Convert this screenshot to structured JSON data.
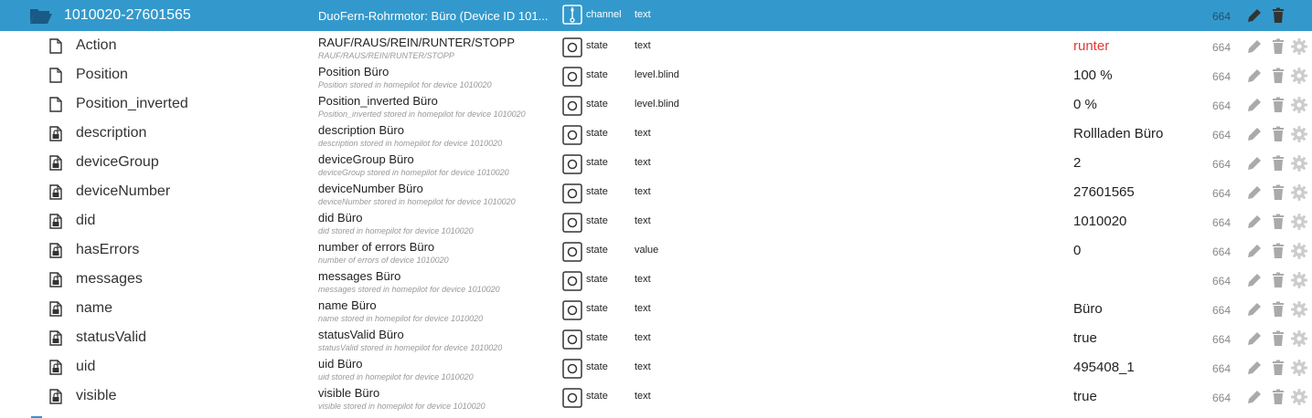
{
  "colors": {
    "header_bg": "#3399cc",
    "header_text": "#ffffff",
    "value_alert": "#e53935",
    "icon_gray": "#aaaaaa"
  },
  "header": {
    "name": "1010020-27601565",
    "title": "DuoFern-Rohrmotor: Büro (Device ID 101...",
    "type": "channel",
    "role": "text",
    "acl": "664",
    "icon": "folder-open-icon",
    "type_icon": "channel-icon"
  },
  "rows": [
    {
      "name": "Action",
      "icon": "file-icon",
      "title": "RAUF/RAUS/REIN/RUNTER/STOPP",
      "desc": "RAUF/RAUS/REIN/RUNTER/STOPP",
      "type": "state",
      "role": "text",
      "value": "runter",
      "acl": "664"
    },
    {
      "name": "Position",
      "icon": "file-icon",
      "title": "Position Büro",
      "desc": "Position stored in homepilot for device 1010020",
      "type": "state",
      "role": "level.blind",
      "value": "100 %",
      "acl": "664"
    },
    {
      "name": "Position_inverted",
      "icon": "file-icon",
      "title": "Position_inverted Büro",
      "desc": "Position_inverted stored in homepilot for device 1010020",
      "type": "state",
      "role": "level.blind",
      "value": "0 %",
      "acl": "664"
    },
    {
      "name": "description",
      "icon": "locked-file-icon",
      "title": "description Büro",
      "desc": "description stored in homepilot for device 1010020",
      "type": "state",
      "role": "text",
      "value": "Rollladen Büro",
      "acl": "664"
    },
    {
      "name": "deviceGroup",
      "icon": "locked-file-icon",
      "title": "deviceGroup Büro",
      "desc": "deviceGroup stored in homepilot for device 1010020",
      "type": "state",
      "role": "text",
      "value": "2",
      "acl": "664"
    },
    {
      "name": "deviceNumber",
      "icon": "locked-file-icon",
      "title": "deviceNumber Büro",
      "desc": "deviceNumber stored in homepilot for device 1010020",
      "type": "state",
      "role": "text",
      "value": "27601565",
      "acl": "664"
    },
    {
      "name": "did",
      "icon": "locked-file-icon",
      "title": "did Büro",
      "desc": "did stored in homepilot for device 1010020",
      "type": "state",
      "role": "text",
      "value": "1010020",
      "acl": "664"
    },
    {
      "name": "hasErrors",
      "icon": "locked-file-icon",
      "title": "number of errors Büro",
      "desc": "number of errors of device 1010020",
      "type": "state",
      "role": "value",
      "value": "0",
      "acl": "664"
    },
    {
      "name": "messages",
      "icon": "locked-file-icon",
      "title": "messages Büro",
      "desc": "messages stored in homepilot for device 1010020",
      "type": "state",
      "role": "text",
      "value": "",
      "acl": "664"
    },
    {
      "name": "name",
      "icon": "locked-file-icon",
      "title": "name Büro",
      "desc": "name stored in homepilot for device 1010020",
      "type": "state",
      "role": "text",
      "value": "Büro",
      "acl": "664"
    },
    {
      "name": "statusValid",
      "icon": "locked-file-icon",
      "title": "statusValid Büro",
      "desc": "statusValid stored in homepilot for device 1010020",
      "type": "state",
      "role": "text",
      "value": "true",
      "acl": "664"
    },
    {
      "name": "uid",
      "icon": "locked-file-icon",
      "title": "uid Büro",
      "desc": "uid stored in homepilot for device 1010020",
      "type": "state",
      "role": "text",
      "value": "495408_1",
      "acl": "664"
    },
    {
      "name": "visible",
      "icon": "locked-file-icon",
      "title": "visible Büro",
      "desc": "visible stored in homepilot for device 1010020",
      "type": "state",
      "role": "text",
      "value": "true",
      "acl": "664"
    }
  ]
}
